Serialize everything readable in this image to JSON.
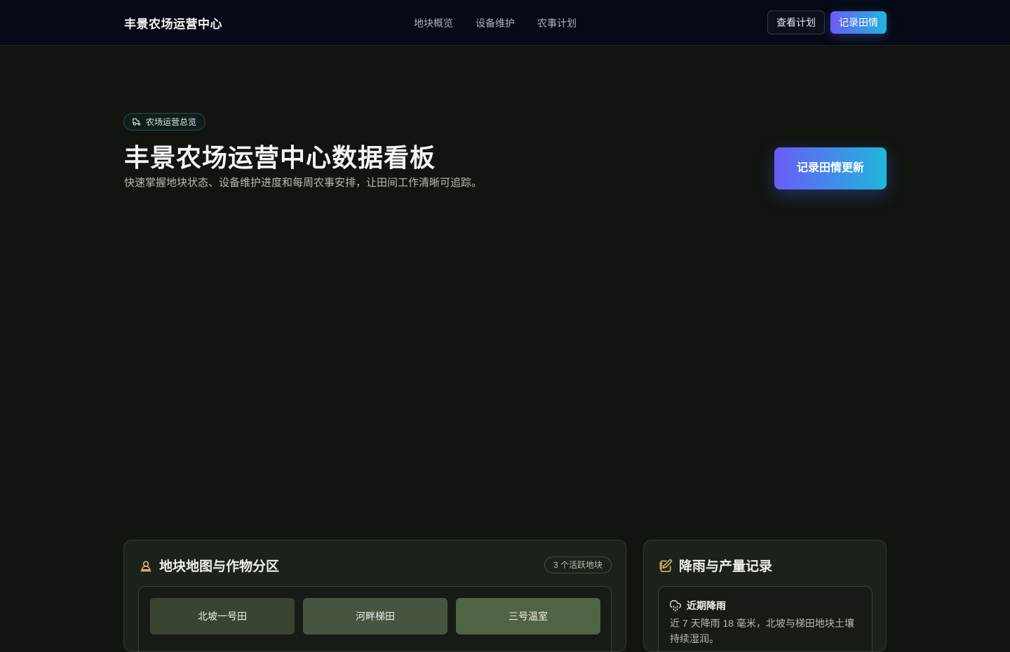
{
  "header": {
    "brand": "丰景农场运营中心",
    "nav": [
      "地块概览",
      "设备维护",
      "农事计划"
    ],
    "view_plan_label": "查看计划",
    "record_label": "记录田情"
  },
  "hero": {
    "pill_label": "农场运营总览",
    "title": "丰景农场运营中心数据看板",
    "subtitle": "快速掌握地块状态、设备维护进度和每周农事安排，让田间工作清晰可追踪。",
    "cta_label": "记录田情更新"
  },
  "map_card": {
    "title": "地块地图与作物分区",
    "badge": "3 个活跃地块",
    "plots": [
      "北坡一号田",
      "河畔梯田",
      "三号温室"
    ]
  },
  "rain_card": {
    "title": "降雨与产量记录",
    "recent_title": "近期降雨",
    "recent_text": "近 7 天降雨 18 毫米，北坡与梯田地块土壤持续湿润。"
  },
  "colors": {
    "accent_start": "#6a5cf6",
    "accent_end": "#1fb6dc",
    "icon_gold": "#d9b36a"
  },
  "icons": {
    "pill": "tractor-icon",
    "map_card": "map-pin-icon",
    "rain_card": "notebook-pen-icon",
    "recent": "cloud-rain-icon"
  }
}
